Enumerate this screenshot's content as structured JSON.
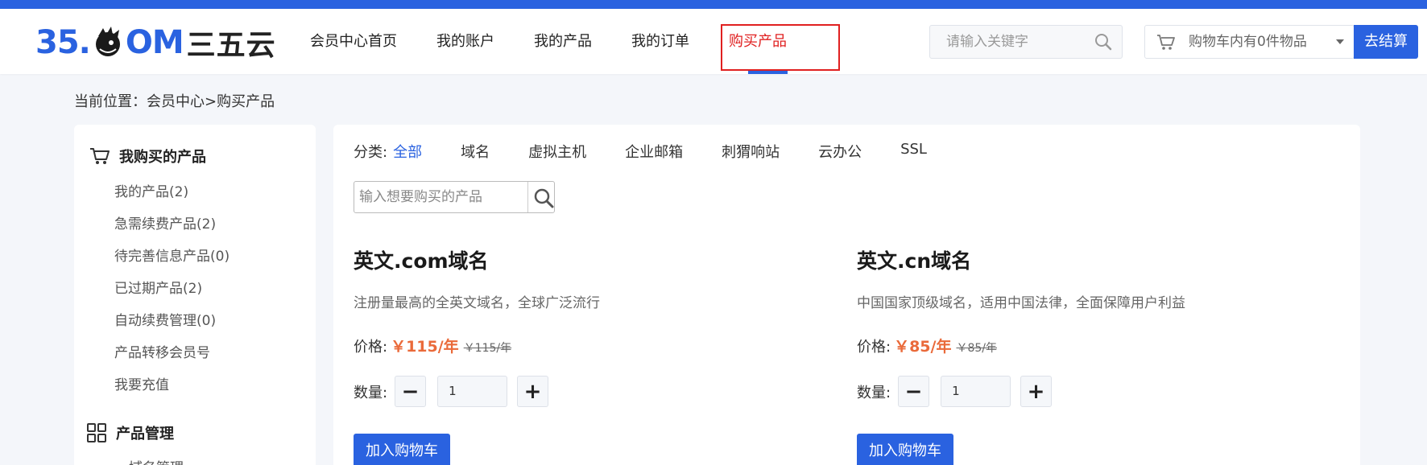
{
  "header": {
    "logo_prefix": "35.",
    "logo_suffix": "OM",
    "logo_cn": "三五云",
    "nav": [
      "会员中心首页",
      "我的账户",
      "我的产品",
      "我的订单",
      "购买产品"
    ],
    "active_nav_index": 4,
    "search_placeholder": "请输入关键字",
    "cart_text": "购物车内有0件物品",
    "checkout_label": "去结算"
  },
  "breadcrumb": "当前位置：会员中心>购买产品",
  "sidebar": {
    "section1_title": "我购买的产品",
    "section1_items": [
      "我的产品(2)",
      "急需续费产品(2)",
      "待完善信息产品(0)",
      "已过期产品(2)",
      "自动续费管理(0)",
      "产品转移会员号",
      "我要充值"
    ],
    "section2_title": "产品管理",
    "section2_items": [
      "域名管理"
    ]
  },
  "main": {
    "category_label": "分类:",
    "categories": [
      "全部",
      "域名",
      "虚拟主机",
      "企业邮箱",
      "刺猬响站",
      "云办公",
      "SSL"
    ],
    "active_category_index": 0,
    "product_search_placeholder": "输入想要购买的产品",
    "products": [
      {
        "name": "英文.com域名",
        "desc": "注册量最高的全英文域名，全球广泛流行",
        "price_label": "价格:",
        "price": "￥115/年",
        "old_price": "￥115/年",
        "qty_label": "数量:",
        "qty": "1",
        "add_label": "加入购物车"
      },
      {
        "name": "英文.cn域名",
        "desc": "中国国家顶级域名，适用中国法律，全面保障用户利益",
        "price_label": "价格:",
        "price": "￥85/年",
        "old_price": "￥85/年",
        "qty_label": "数量:",
        "qty": "1",
        "add_label": "加入购物车"
      }
    ]
  },
  "colors": {
    "brand_blue": "#2a62e0",
    "price_orange": "#ea6a3a",
    "active_red": "#e02020"
  }
}
